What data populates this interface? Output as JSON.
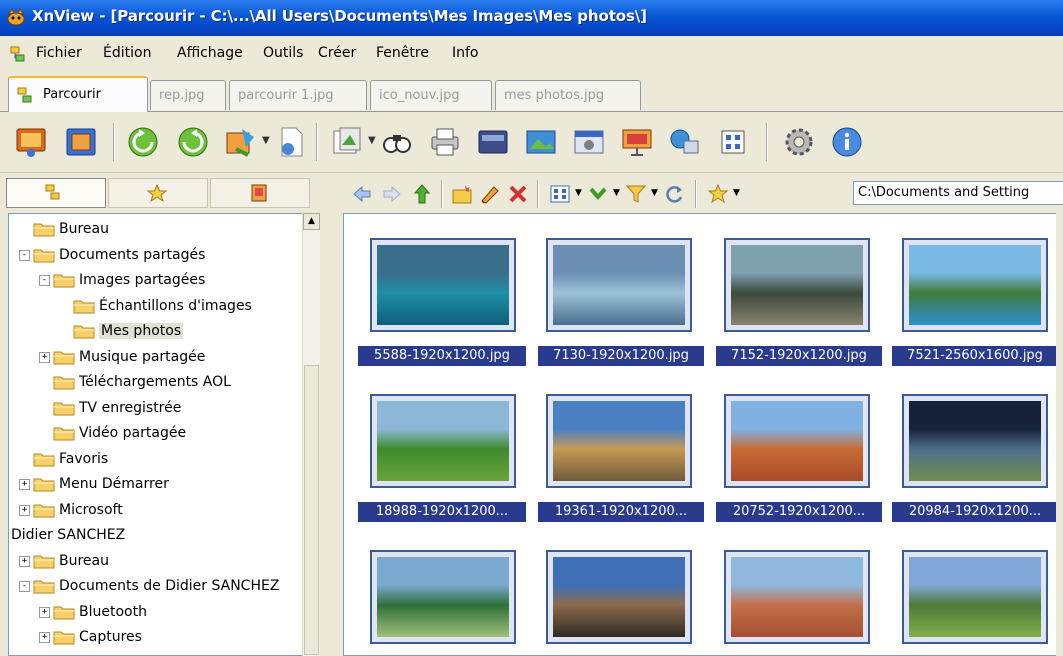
{
  "window": {
    "title": "XnView - [Parcourir - C:\\...\\All Users\\Documents\\Mes Images\\Mes photos\\]"
  },
  "menu": [
    "Fichier",
    "Édition",
    "Affichage",
    "Outils",
    "Créer",
    "Fenêtre",
    "Info"
  ],
  "tabs": [
    "Parcourir",
    "rep.jpg",
    "parcourir 1.jpg",
    "ico_nouv.jpg",
    "mes photos.jpg"
  ],
  "toolbar_icons": [
    "slideshow-icon",
    "fullscreen-icon",
    "rotate-left-icon",
    "rotate-right-icon",
    "convert-icon",
    "new-document-icon",
    "batch-icon",
    "search-icon",
    "print-icon",
    "scanner-icon",
    "web-icon",
    "capture-icon",
    "slideshow-create-icon",
    "network-icon",
    "contact-sheet-icon",
    "settings-icon",
    "info-icon"
  ],
  "path": "C:\\Documents and Setting",
  "tree": [
    {
      "label": "Bureau",
      "depth": 1,
      "exp": ""
    },
    {
      "label": "Documents partagés",
      "depth": 1,
      "exp": "−"
    },
    {
      "label": "Images partagées",
      "depth": 2,
      "exp": "−"
    },
    {
      "label": "Échantillons d'images",
      "depth": 3,
      "exp": ""
    },
    {
      "label": "Mes photos",
      "depth": 3,
      "exp": "",
      "selected": true
    },
    {
      "label": "Musique partagée",
      "depth": 2,
      "exp": "+"
    },
    {
      "label": "Téléchargements AOL",
      "depth": 2,
      "exp": ""
    },
    {
      "label": "TV enregistrée",
      "depth": 2,
      "exp": ""
    },
    {
      "label": "Vidéo partagée",
      "depth": 2,
      "exp": ""
    },
    {
      "label": "Favoris",
      "depth": 1,
      "exp": ""
    },
    {
      "label": "Menu Démarrer",
      "depth": 1,
      "exp": "+"
    },
    {
      "label": "Microsoft",
      "depth": 1,
      "exp": "+"
    },
    {
      "label": "Didier SANCHEZ",
      "depth": 0,
      "exp": ""
    },
    {
      "label": "Bureau",
      "depth": 1,
      "exp": "+"
    },
    {
      "label": "Documents de Didier SANCHEZ",
      "depth": 1,
      "exp": "−"
    },
    {
      "label": "Bluetooth",
      "depth": 2,
      "exp": "+"
    },
    {
      "label": "Captures",
      "depth": 2,
      "exp": "+"
    }
  ],
  "thumbnails": [
    {
      "name": "5588-1920x1200.jpg",
      "colors": [
        "#3a6f8c",
        "#1e8ea6",
        "#0f5f7a"
      ]
    },
    {
      "name": "7130-1920x1200.jpg",
      "colors": [
        "#6a8fb3",
        "#9ec2d8",
        "#4a6f8e"
      ]
    },
    {
      "name": "7152-1920x1200.jpg",
      "colors": [
        "#7fa0ad",
        "#3a4a3c",
        "#8a8370"
      ]
    },
    {
      "name": "7521-2560x1600.jpg",
      "colors": [
        "#79b9e3",
        "#3f7b3a",
        "#2a8fd0"
      ]
    },
    {
      "name": "18988-1920x1200...",
      "colors": [
        "#8cb7d6",
        "#3e8b2f",
        "#6aa43a"
      ]
    },
    {
      "name": "19361-1920x1200...",
      "colors": [
        "#4a7fc3",
        "#c79a55",
        "#6d5a3b"
      ]
    },
    {
      "name": "20752-1920x1200...",
      "colors": [
        "#7fb2e2",
        "#c96b34",
        "#a64a2a"
      ]
    },
    {
      "name": "20984-1920x1200...",
      "colors": [
        "#15223a",
        "#4f6f8a",
        "#6f8d4e"
      ]
    },
    {
      "name": "",
      "colors": [
        "#7aa8cf",
        "#2f6f3a",
        "#9fc07a"
      ]
    },
    {
      "name": "",
      "colors": [
        "#3f6fb5",
        "#8b6a4c",
        "#2d2a24"
      ]
    },
    {
      "name": "",
      "colors": [
        "#8fb8dd",
        "#c4704a",
        "#a44f33"
      ]
    },
    {
      "name": "",
      "colors": [
        "#7fa6d6",
        "#4f7a3a",
        "#7fb04a"
      ]
    }
  ]
}
